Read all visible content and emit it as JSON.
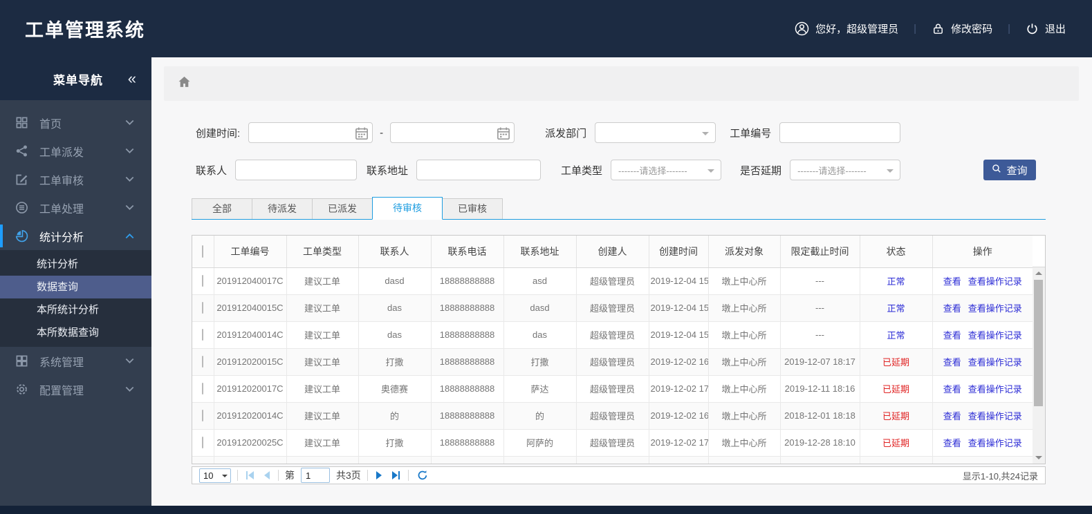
{
  "app": {
    "title": "工单管理系统"
  },
  "header": {
    "greeting": "您好，超级管理员",
    "change_password": "修改密码",
    "logout": "退出",
    "separator": "|"
  },
  "sidebar": {
    "title": "菜单导航",
    "collapse_glyph": "«",
    "items": [
      {
        "key": "home",
        "label": "首页",
        "icon": "grid-icon"
      },
      {
        "key": "dispatch",
        "label": "工单派发",
        "icon": "share-icon"
      },
      {
        "key": "review",
        "label": "工单审核",
        "icon": "edit-icon"
      },
      {
        "key": "process",
        "label": "工单处理",
        "icon": "database-icon"
      },
      {
        "key": "stats",
        "label": "统计分析",
        "icon": "pie-chart-icon",
        "active": true,
        "expanded": true,
        "children": [
          {
            "key": "stats-analysis",
            "label": "统计分析"
          },
          {
            "key": "data-query",
            "label": "数据查询",
            "selected": true
          },
          {
            "key": "branch-stats",
            "label": "本所统计分析"
          },
          {
            "key": "branch-query",
            "label": "本所数据查询"
          }
        ]
      },
      {
        "key": "system",
        "label": "系统管理",
        "icon": "th-large-icon"
      },
      {
        "key": "config",
        "label": "配置管理",
        "icon": "gear-icon"
      }
    ]
  },
  "filters": {
    "create_time_label": "创建时间:",
    "range_separator": "-",
    "dispatch_dept_label": "派发部门",
    "order_no_label": "工单编号",
    "contact_label": "联系人",
    "address_label": "联系地址",
    "order_type_label": "工单类型",
    "delay_label": "是否延期",
    "select_placeholder": "-------请选择-------",
    "search_button": "查询"
  },
  "tabs": [
    {
      "key": "all",
      "label": "全部"
    },
    {
      "key": "pending-dispatch",
      "label": "待派发"
    },
    {
      "key": "dispatched",
      "label": "已派发"
    },
    {
      "key": "pending-review",
      "label": "待审核",
      "active": true
    },
    {
      "key": "reviewed",
      "label": "已审核"
    }
  ],
  "table": {
    "columns": [
      "工单编号",
      "工单类型",
      "联系人",
      "联系电话",
      "联系地址",
      "创建人",
      "创建时间",
      "派发对象",
      "限定截止时间",
      "状态",
      "操作"
    ],
    "action_labels": [
      "查看",
      "查看操作记录"
    ],
    "rows": [
      {
        "no": "201912040017C",
        "type": "建议工单",
        "contact": "dasd",
        "phone": "18888888888",
        "address": "asd",
        "creator": "超级管理员",
        "created": "2019-12-04 15",
        "target": "墩上中心所",
        "deadline": "---",
        "status": "正常",
        "status_type": "normal"
      },
      {
        "no": "201912040015C",
        "type": "建议工单",
        "contact": "das",
        "phone": "18888888888",
        "address": "dasd",
        "creator": "超级管理员",
        "created": "2019-12-04 15",
        "target": "墩上中心所",
        "deadline": "---",
        "status": "正常",
        "status_type": "normal"
      },
      {
        "no": "201912040014C",
        "type": "建议工单",
        "contact": "das",
        "phone": "18888888888",
        "address": "das",
        "creator": "超级管理员",
        "created": "2019-12-04 15",
        "target": "墩上中心所",
        "deadline": "---",
        "status": "正常",
        "status_type": "normal"
      },
      {
        "no": "201912020015C",
        "type": "建议工单",
        "contact": "打撒",
        "phone": "18888888888",
        "address": "打撒",
        "creator": "超级管理员",
        "created": "2019-12-02 16",
        "target": "墩上中心所",
        "deadline": "2019-12-07 18:17",
        "status": "已延期",
        "status_type": "delayed"
      },
      {
        "no": "201912020017C",
        "type": "建议工单",
        "contact": "奥德赛",
        "phone": "18888888888",
        "address": "萨达",
        "creator": "超级管理员",
        "created": "2019-12-02 17",
        "target": "墩上中心所",
        "deadline": "2019-12-11 18:16",
        "status": "已延期",
        "status_type": "delayed"
      },
      {
        "no": "201912020014C",
        "type": "建议工单",
        "contact": "的",
        "phone": "18888888888",
        "address": "的",
        "creator": "超级管理员",
        "created": "2019-12-02 16",
        "target": "墩上中心所",
        "deadline": "2018-12-01 18:18",
        "status": "已延期",
        "status_type": "delayed"
      },
      {
        "no": "201912020025C",
        "type": "建议工单",
        "contact": "打撒",
        "phone": "18888888888",
        "address": "阿萨的",
        "creator": "超级管理员",
        "created": "2019-12-02 17",
        "target": "墩上中心所",
        "deadline": "2019-12-28 18:10",
        "status": "已延期",
        "status_type": "delayed"
      },
      {
        "no": "",
        "type": "",
        "contact": "",
        "phone": "",
        "address": "",
        "creator": "",
        "created": "",
        "target": "",
        "deadline": "",
        "status": "",
        "status_type": "none",
        "partial": true
      }
    ]
  },
  "pagination": {
    "page_size": "10",
    "page_prefix": "第",
    "current_page": "1",
    "total_pages": "共3页",
    "summary": "显示1-10,共24记录"
  },
  "colors": {
    "header_bg": "#1c2b42",
    "sidebar_bg": "#333e4f",
    "submenu_bg": "#262f3d",
    "selected_submenu_bg": "#4e5d8c",
    "active_accent": "#1e9dff",
    "tab_accent": "#1e9de0",
    "link_blue": "#2b2bd5",
    "status_normal": "#2b2bd5",
    "status_delayed": "#e02222",
    "search_button_bg": "#3d5a98",
    "footer_bg": "#142238"
  }
}
